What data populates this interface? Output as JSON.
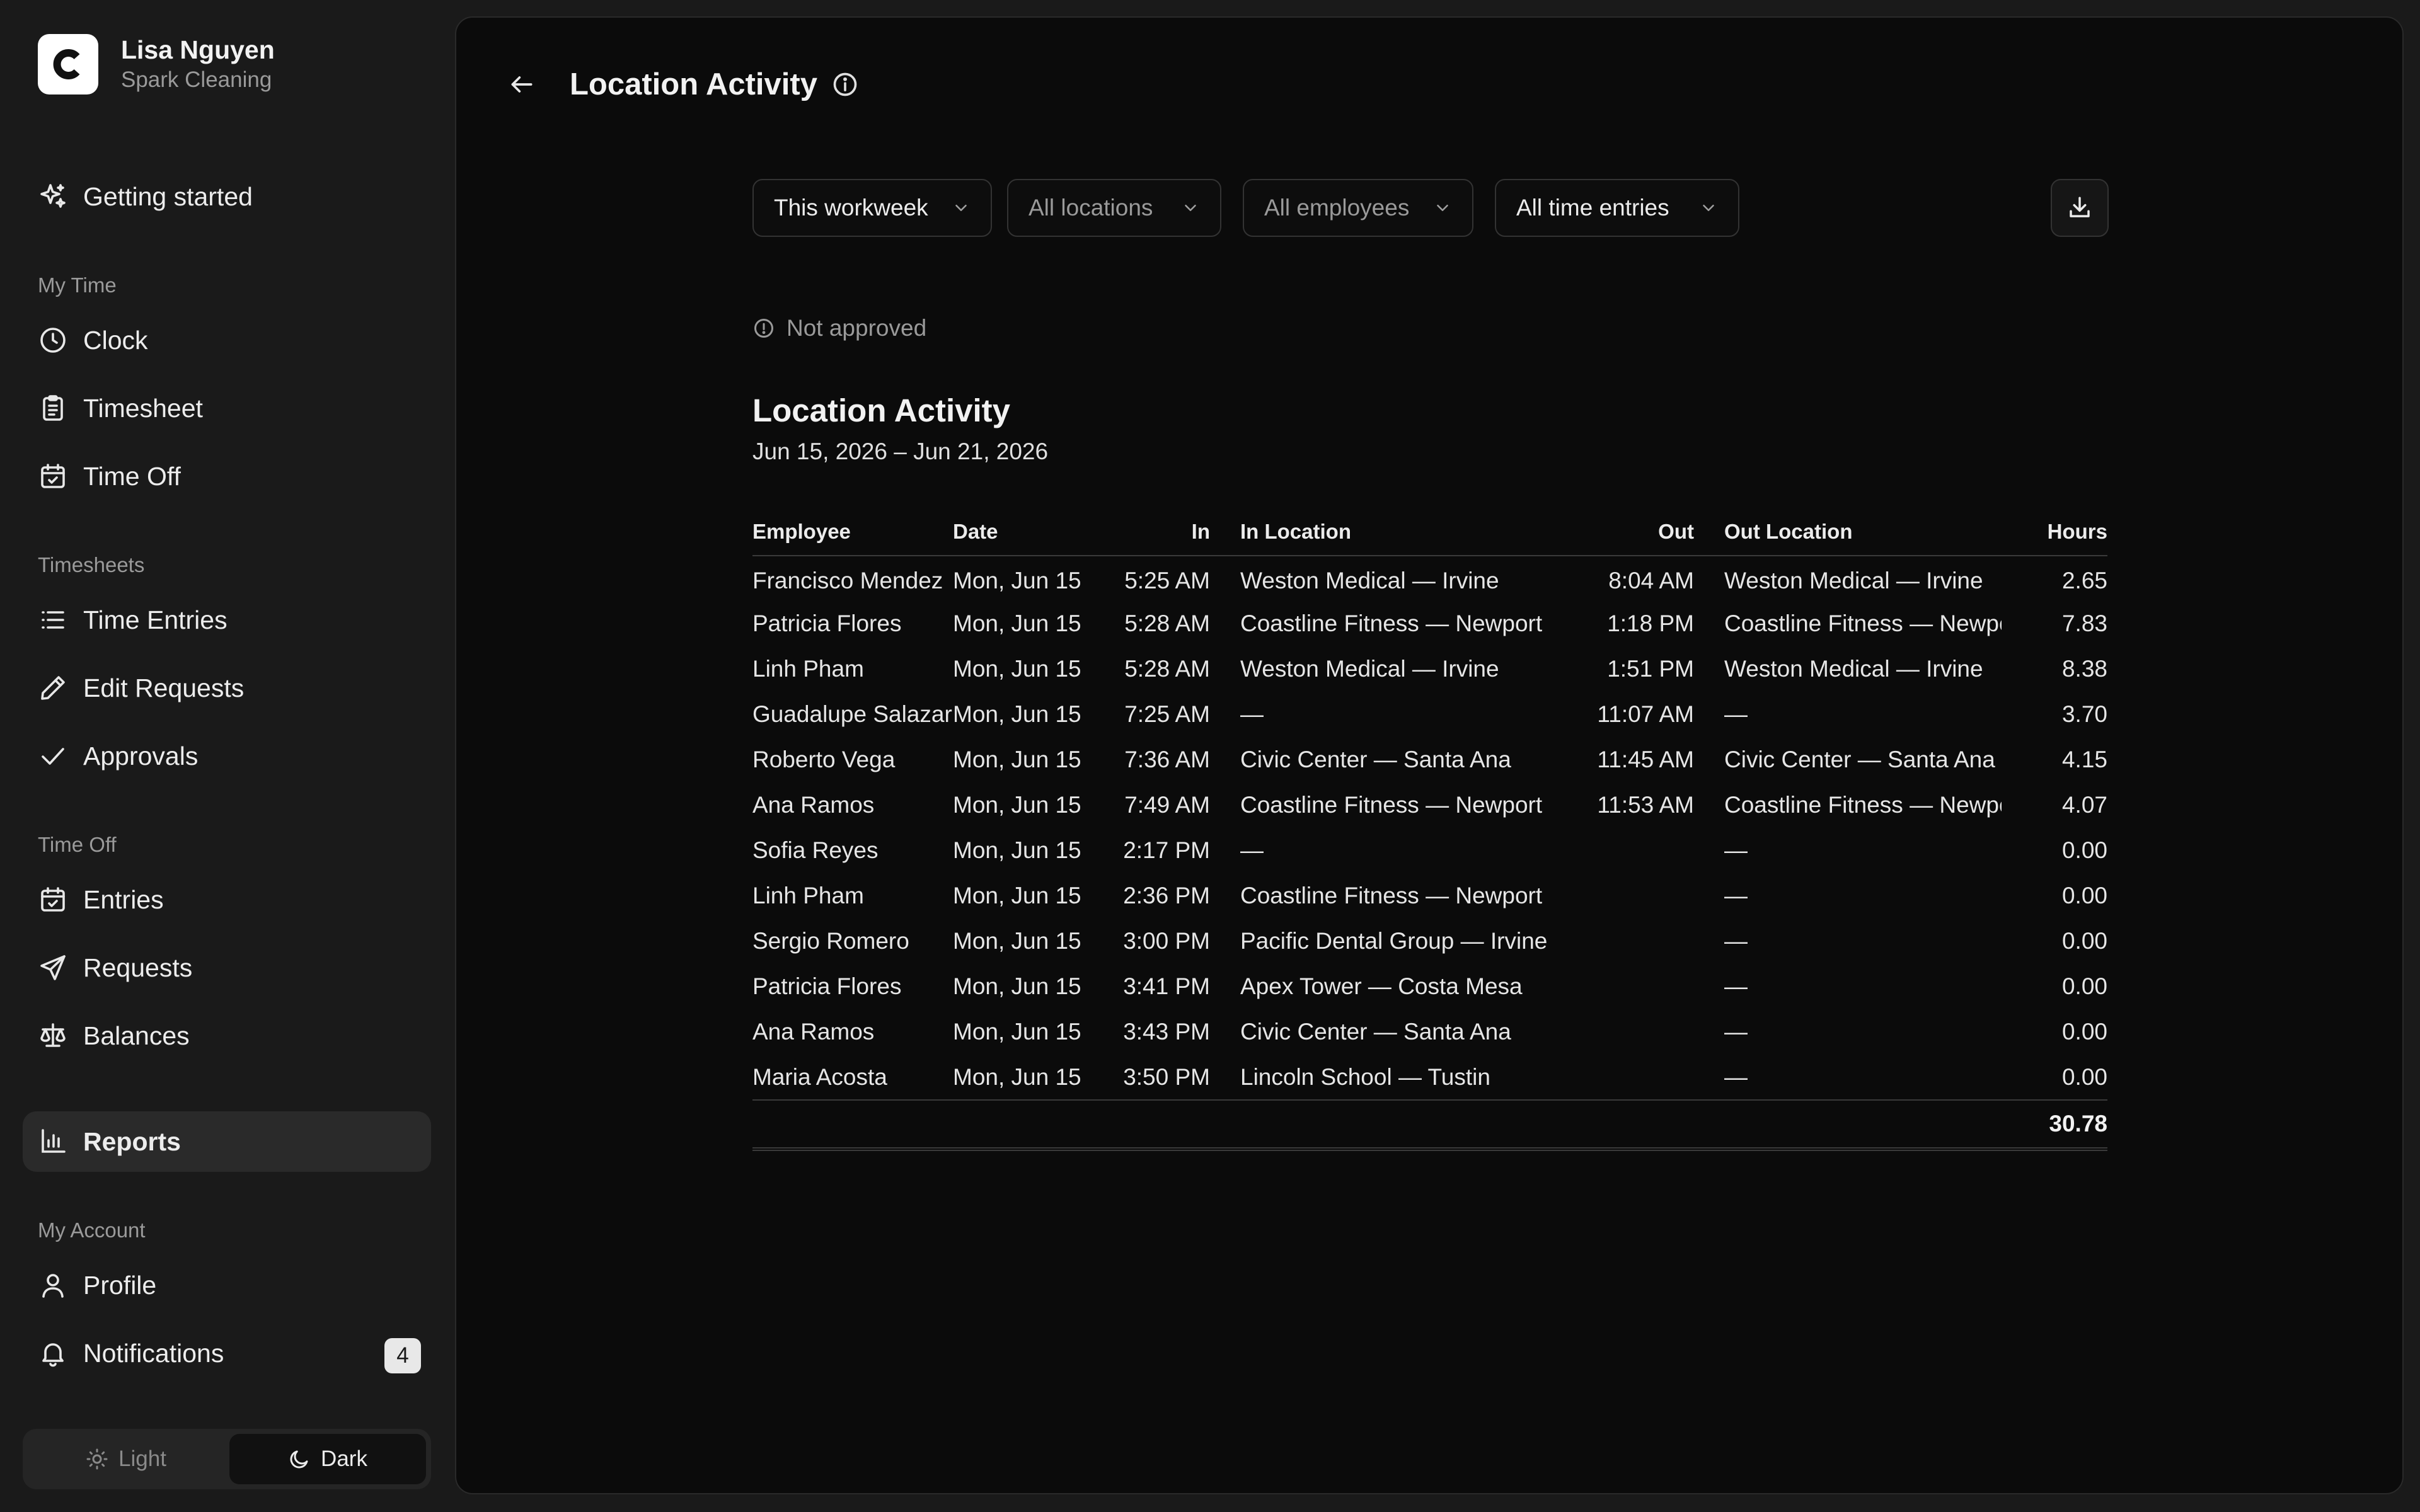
{
  "account": {
    "logo_letter": "C",
    "name": "Lisa Nguyen",
    "org": "Spark Cleaning"
  },
  "nav": {
    "getting_started": "Getting started",
    "sections": {
      "my_time": "My Time",
      "timesheets": "Timesheets",
      "time_off": "Time Off",
      "my_account": "My Account"
    },
    "items": {
      "clock": "Clock",
      "timesheet": "Timesheet",
      "time_off": "Time Off",
      "time_entries": "Time Entries",
      "edit_requests": "Edit Requests",
      "approvals": "Approvals",
      "entries": "Entries",
      "requests": "Requests",
      "balances": "Balances",
      "reports": "Reports",
      "profile": "Profile",
      "notifications": "Notifications"
    },
    "notifications_badge": "4",
    "active_item": "Reports"
  },
  "theme": {
    "light_label": "Light",
    "dark_label": "Dark",
    "selected": "Dark"
  },
  "header": {
    "title": "Location Activity"
  },
  "filters": {
    "period": "This workweek",
    "locations": "All locations",
    "employees": "All employees",
    "entries": "All time entries"
  },
  "status": "Not approved",
  "report": {
    "title": "Location Activity",
    "date_range": "Jun 15, 2026 – Jun 21, 2026",
    "columns": [
      "Employee",
      "Date",
      "In",
      "In Location",
      "Out",
      "Out Location",
      "Hours"
    ],
    "rows": [
      [
        "Francisco Mendez",
        "Mon, Jun 15",
        "5:25 AM",
        "Weston Medical — Irvine",
        "8:04 AM",
        "Weston Medical — Irvine",
        "2.65"
      ],
      [
        "Patricia Flores",
        "Mon, Jun 15",
        "5:28 AM",
        "Coastline Fitness — Newport",
        "1:18 PM",
        "Coastline Fitness — Newport",
        "7.83"
      ],
      [
        "Linh Pham",
        "Mon, Jun 15",
        "5:28 AM",
        "Weston Medical — Irvine",
        "1:51 PM",
        "Weston Medical — Irvine",
        "8.38"
      ],
      [
        "Guadalupe Salazar",
        "Mon, Jun 15",
        "7:25 AM",
        "—",
        "11:07 AM",
        "—",
        "3.70"
      ],
      [
        "Roberto Vega",
        "Mon, Jun 15",
        "7:36 AM",
        "Civic Center — Santa Ana",
        "11:45 AM",
        "Civic Center — Santa Ana",
        "4.15"
      ],
      [
        "Ana Ramos",
        "Mon, Jun 15",
        "7:49 AM",
        "Coastline Fitness — Newport",
        "11:53 AM",
        "Coastline Fitness — Newport",
        "4.07"
      ],
      [
        "Sofia Reyes",
        "Mon, Jun 15",
        "2:17 PM",
        "—",
        "",
        "—",
        "0.00"
      ],
      [
        "Linh Pham",
        "Mon, Jun 15",
        "2:36 PM",
        "Coastline Fitness — Newport",
        "",
        "—",
        "0.00"
      ],
      [
        "Sergio Romero",
        "Mon, Jun 15",
        "3:00 PM",
        "Pacific Dental Group — Irvine",
        "",
        "—",
        "0.00"
      ],
      [
        "Patricia Flores",
        "Mon, Jun 15",
        "3:41 PM",
        "Apex Tower — Costa Mesa",
        "",
        "—",
        "0.00"
      ],
      [
        "Ana Ramos",
        "Mon, Jun 15",
        "3:43 PM",
        "Civic Center — Santa Ana",
        "",
        "—",
        "0.00"
      ],
      [
        "Maria Acosta",
        "Mon, Jun 15",
        "3:50 PM",
        "Lincoln School — Tustin",
        "",
        "—",
        "0.00"
      ]
    ],
    "total_hours": "30.78"
  }
}
